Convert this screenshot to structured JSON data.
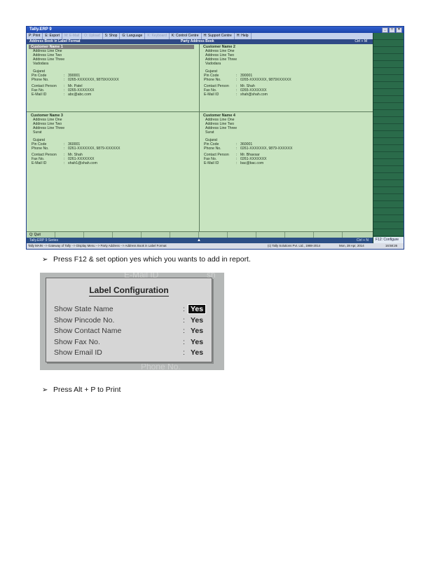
{
  "tally": {
    "title": "Tally.ERP 9",
    "menu": [
      {
        "label": "P: Print",
        "dim": false
      },
      {
        "label": "E: Export",
        "dim": false
      },
      {
        "label": "M: E-Mail",
        "dim": true
      },
      {
        "label": "O: Upload",
        "dim": true
      },
      {
        "label": "S: Shop",
        "dim": false
      },
      {
        "label": "G: Language",
        "dim": false
      },
      {
        "label": "K: Keyboard",
        "dim": true
      },
      {
        "label": "K: Control Centre",
        "dim": false
      },
      {
        "label": "H: Support Centre",
        "dim": false
      },
      {
        "label": "H: Help",
        "dim": false
      }
    ],
    "header_left": "Address Book in Label Format",
    "header_center": "Party Address Book",
    "header_right": "Ctrl + M",
    "customers": [
      {
        "name": "Customer Name 1",
        "address": [
          "Address Line One",
          "Address Line Two",
          "Address Line Three",
          "Vadodara"
        ],
        "state": "Gujarat",
        "fields": [
          {
            "k": "Pin Code",
            "v": "390001"
          },
          {
            "k": "Phone No.",
            "v": "0265-XXXXXXX, 9879XXXXXX"
          }
        ],
        "contact": [
          {
            "k": "Contact Person",
            "v": "Mr. Patel"
          },
          {
            "k": "Fax No.",
            "v": "0265-XXXXXXX"
          },
          {
            "k": "E-Mail ID",
            "v": "abc@abc.com"
          }
        ]
      },
      {
        "name": "Customer Name 2",
        "address": [
          "Address Line One",
          "Address Line Two",
          "Address Line Three",
          "Vadodara"
        ],
        "state": "Gujarat",
        "fields": [
          {
            "k": "Pin Code",
            "v": "390001"
          },
          {
            "k": "Phone No.",
            "v": "0265-XXXXXXX, 9879XXXXXX"
          }
        ],
        "contact": [
          {
            "k": "Contact Person",
            "v": "Mr. Shah"
          },
          {
            "k": "Fax No.",
            "v": "0265-XXXXXXX"
          },
          {
            "k": "E-Mail ID",
            "v": "shah@shah.com"
          }
        ]
      },
      {
        "name": "Customer Name 3",
        "address": [
          "Address Line One",
          "Address Line Two",
          "Address Line Three",
          "Surat"
        ],
        "state": "Gujarat",
        "fields": [
          {
            "k": "Pin Code",
            "v": "360001"
          },
          {
            "k": "Phone No.",
            "v": "0261-XXXXXXX, 9879-XXXXXX"
          }
        ],
        "contact": [
          {
            "k": "Contact Person",
            "v": "Mr. Shah"
          },
          {
            "k": "Fax No.",
            "v": "0261-XXXXXXX"
          },
          {
            "k": "E-Mail ID",
            "v": "shah1@shah.com"
          }
        ]
      },
      {
        "name": "Customer Name 4",
        "address": [
          "Address Line One",
          "Address Line Two",
          "Address Line Three",
          "Surat"
        ],
        "state": "Gujarat",
        "fields": [
          {
            "k": "Pin Code",
            "v": "360001"
          },
          {
            "k": "Phone No.",
            "v": "0261-XXXXXXX, 9879-XXXXXX"
          }
        ],
        "contact": [
          {
            "k": "Contact Person",
            "v": "Mr. Bhavsar"
          },
          {
            "k": "Fax No.",
            "v": "0261-XXXXXXX"
          },
          {
            "k": "E-Mail ID",
            "v": "bac@bac.com"
          }
        ]
      }
    ],
    "quit_label": "Q: Quit",
    "status_version": "Tally.ERP 9 Series",
    "status_ctrl": "Ctrl + N",
    "path": "Tally MAIN --> Gateway of Tally --> Display Menu --> Party Address --> Address Book in Label Format",
    "copyright": "(c) Tally Solutions Pvt. Ltd., 1988-2014",
    "date": "Mon, 28 Apr, 2014",
    "time": "16:58:26",
    "configure_label": "F12: Configure"
  },
  "instructions": {
    "step1": "Press F12 & set option yes which you wants to add in report.",
    "step2": "Press Alt + P to Print",
    "bullet": "➢"
  },
  "dialog": {
    "ghost_top": "E-Mail ID",
    "ghost_top_right": "sh",
    "ghost_bottom": "Phone No.",
    "title": "Label Configuration",
    "options": [
      {
        "label": "Show State Name",
        "value": "Yes",
        "selected": true
      },
      {
        "label": "Show Pincode No.",
        "value": "Yes",
        "selected": false
      },
      {
        "label": "Show Contact Name",
        "value": "Yes",
        "selected": false
      },
      {
        "label": "Show Fax No.",
        "value": "Yes",
        "selected": false
      },
      {
        "label": "Show Email ID",
        "value": "Yes",
        "selected": false
      }
    ],
    "colon": ":"
  }
}
